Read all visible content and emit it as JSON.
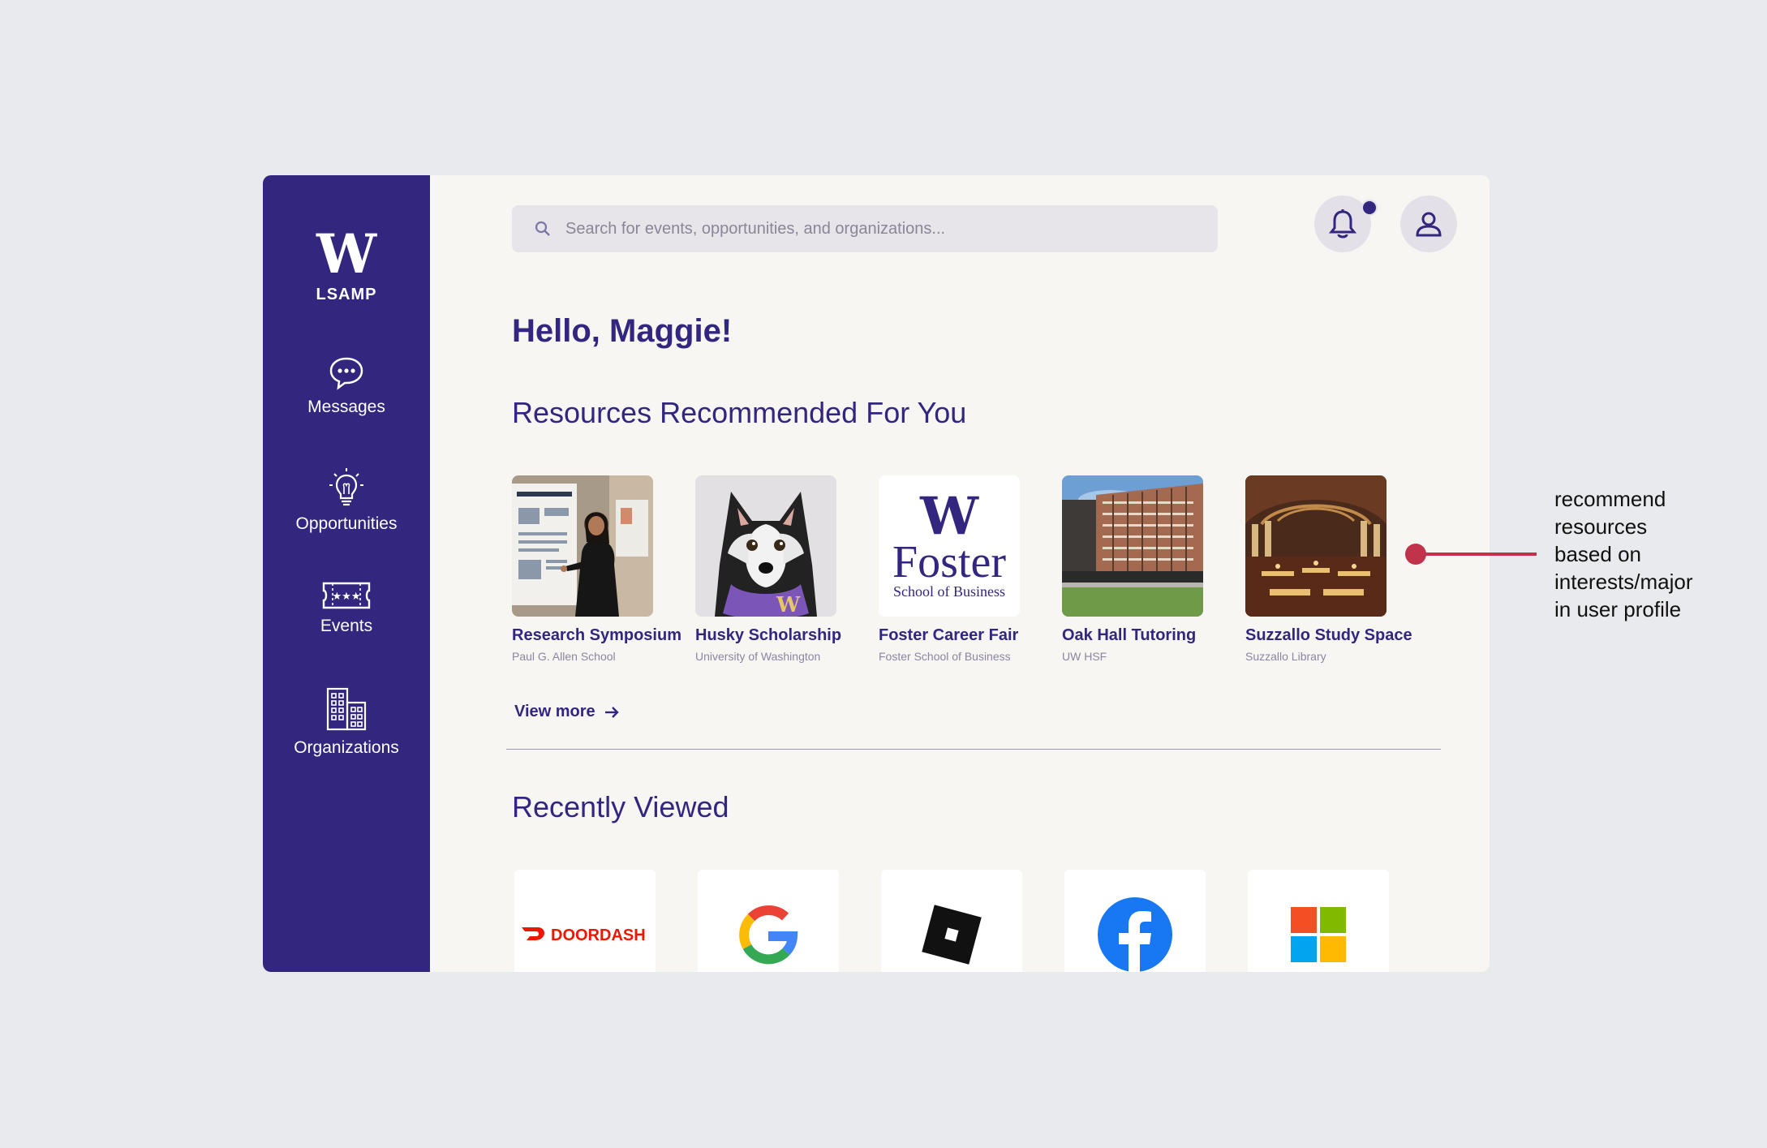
{
  "sidebar": {
    "logo_mark": "W",
    "logo_text": "LSAMP",
    "items": [
      {
        "label": "Messages",
        "icon": "chat-bubble-icon"
      },
      {
        "label": "Opportunities",
        "icon": "lightbulb-icon"
      },
      {
        "label": "Events",
        "icon": "ticket-icon"
      },
      {
        "label": "Organizations",
        "icon": "buildings-icon"
      }
    ]
  },
  "header": {
    "search_placeholder": "Search for events, opportunities, and organizations...",
    "notification_icon": "bell-icon",
    "profile_icon": "user-icon"
  },
  "greeting": "Hello, Maggie!",
  "recommended": {
    "title": "Resources Recommended  For You",
    "items": [
      {
        "title": "Research Symposium",
        "subtitle": "Paul G. Allen School"
      },
      {
        "title": "Husky Scholarship",
        "subtitle": "University of Washington"
      },
      {
        "title": "Foster Career Fair",
        "subtitle": "Foster School of Business",
        "logo_mark": "W",
        "logo_word": "Foster",
        "logo_sub": "School of Business"
      },
      {
        "title": "Oak Hall Tutoring",
        "subtitle": "UW HSF"
      },
      {
        "title": "Suzzallo Study Space",
        "subtitle": "Suzzallo Library"
      }
    ],
    "view_more": "View more"
  },
  "recent": {
    "title": "Recently Viewed",
    "items": [
      {
        "name": "doordash-logo",
        "text": "DOORDASH"
      },
      {
        "name": "google-logo"
      },
      {
        "name": "roblox-logo"
      },
      {
        "name": "facebook-logo"
      },
      {
        "name": "microsoft-logo"
      }
    ]
  },
  "annotation": {
    "lines": [
      "recommend",
      "resources",
      "based on",
      "interests/major",
      "in user profile"
    ]
  },
  "colors": {
    "brand_purple": "#32267f",
    "background": "#f7f6f2",
    "annotation_red": "#c0334a"
  }
}
